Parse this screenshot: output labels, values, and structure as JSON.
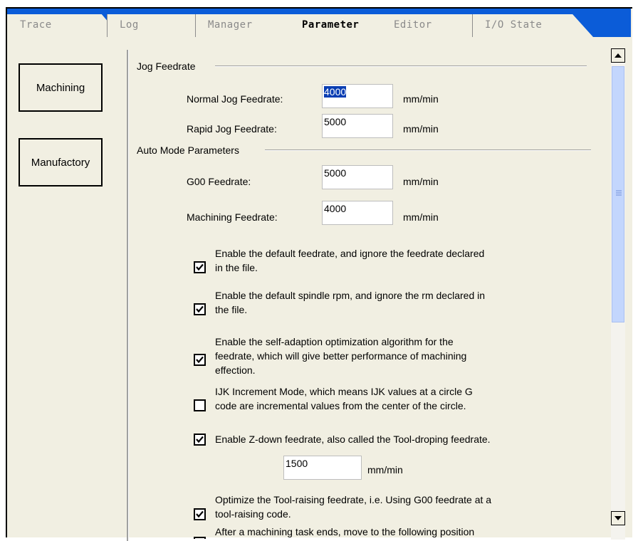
{
  "tabs": [
    {
      "label": "Trace",
      "active": false
    },
    {
      "label": "Log",
      "active": false
    },
    {
      "label": "Manager",
      "active": false
    },
    {
      "label": "Parameter",
      "active": true
    },
    {
      "label": "Editor",
      "active": false
    },
    {
      "label": "I/O State",
      "active": false
    }
  ],
  "sidebar": {
    "machining_label": "Machining",
    "manufactory_label": "Manufactory"
  },
  "jog": {
    "title": "Jog Feedrate",
    "normal_label": "Normal Jog Feedrate:",
    "normal_value": "4000",
    "rapid_label": "Rapid Jog Feedrate:",
    "rapid_value": "5000",
    "unit": "mm/min"
  },
  "auto": {
    "title": "Auto Mode Parameters",
    "g00_label": "G00 Feedrate:",
    "g00_value": "5000",
    "machining_label": "Machining Feedrate:",
    "machining_value": "4000",
    "unit": "mm/min"
  },
  "options": [
    {
      "lines": [
        "Enable the default feedrate, and ignore the feedrate declared",
        "in the file."
      ],
      "checked": true
    },
    {
      "lines": [
        "Enable the default spindle rpm, and ignore the rm declared in",
        "the file."
      ],
      "checked": true
    },
    {
      "lines": [
        "Enable the self-adaption optimization algorithm for the",
        "feedrate, which will give better performance of machining",
        "effection."
      ],
      "checked": true
    },
    {
      "lines": [
        "IJK Increment Mode, which means IJK values at a circle G",
        "code are incremental values from the center of the circle."
      ],
      "checked": false
    },
    {
      "lines": [
        "Enable Z-down feedrate, also called the Tool-droping feedrate."
      ],
      "checked": true
    },
    {
      "lines": [
        "Optimize the Tool-raising feedrate, i.e. Using G00 feedrate at a",
        "tool-raising code."
      ],
      "checked": true
    },
    {
      "lines": [
        "After a machining task ends, move to the following position"
      ],
      "checked": false
    }
  ],
  "zdown": {
    "value": "1500",
    "unit": "mm/min"
  },
  "colors": {
    "tab_bar": "#0b5cd8",
    "panel": "#f1efe2",
    "selection": "#0a3eb3",
    "scroll_thumb": "#c3d6fd"
  }
}
